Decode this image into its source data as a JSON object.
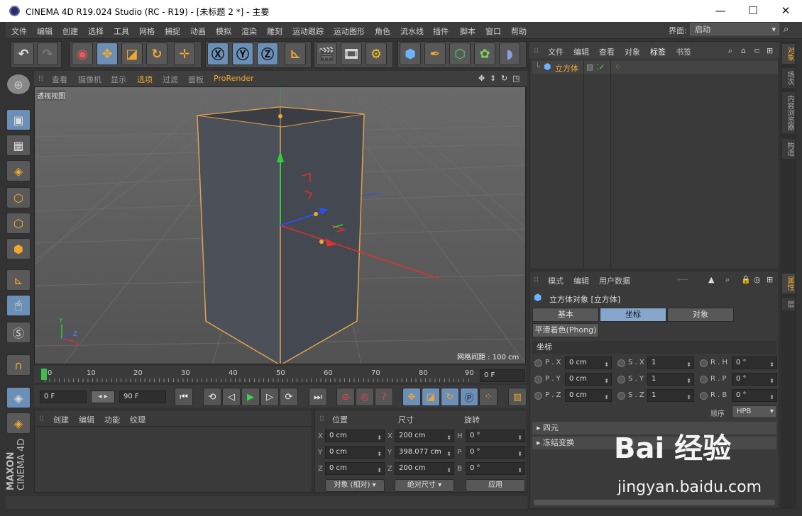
{
  "window": {
    "title": "CINEMA 4D R19.024 Studio (RC - R19) - [未标题 2 *] - 主要"
  },
  "menubar": {
    "items": [
      "文件",
      "编辑",
      "创建",
      "选择",
      "工具",
      "网格",
      "捕捉",
      "动画",
      "模拟",
      "渲染",
      "雕刻",
      "运动跟踪",
      "运动图形",
      "角色",
      "流水线",
      "插件",
      "脚本",
      "窗口",
      "帮助"
    ],
    "layout_label": "界面:",
    "layout_value": "启动"
  },
  "viewport": {
    "menu": [
      "查看",
      "摄像机",
      "显示",
      "选项",
      "过滤",
      "面板",
      "ProRender"
    ],
    "label": "透视视图",
    "grid_spacing": "网格间距 : 100 cm",
    "axis_x": "X",
    "axis_y": "Y",
    "axis_z": "Z"
  },
  "timeline": {
    "ticks": [
      "0",
      "10",
      "20",
      "30",
      "40",
      "50",
      "60",
      "70",
      "80",
      "90"
    ],
    "current_frame": "0 F"
  },
  "playback": {
    "start": "0 F",
    "end": "90 F"
  },
  "material_panel": {
    "menu": [
      "创建",
      "编辑",
      "功能",
      "纹理"
    ]
  },
  "coord_panel": {
    "headers": [
      "位置",
      "尺寸",
      "旋转"
    ],
    "position": {
      "x": "0 cm",
      "y": "0 cm",
      "z": "0 cm"
    },
    "size": {
      "x": "200 cm",
      "y": "398.077 cm",
      "z": "200 cm"
    },
    "rotation": {
      "h": "0 °",
      "p": "0 °",
      "b": "0 °"
    },
    "labels": {
      "x": "X",
      "y": "Y",
      "z": "Z",
      "h": "H",
      "p": "P",
      "b": "B"
    },
    "mode_dropdown": "对象 (相对)",
    "size_dropdown": "绝对尺寸",
    "apply_button": "应用"
  },
  "object_manager": {
    "menu": [
      "文件",
      "编辑",
      "查看",
      "对象",
      "标签",
      "书签"
    ],
    "objects": [
      {
        "name": "立方体"
      }
    ]
  },
  "attribute_manager": {
    "menu": [
      "模式",
      "编辑",
      "用户数据"
    ],
    "object_title": "立方体对象 [立方体]",
    "tabs": [
      "基本",
      "坐标",
      "对象"
    ],
    "phong_tab": "平滑着色(Phong)",
    "section_title": "坐标",
    "p_labels": [
      "P . X",
      "P . Y",
      "P . Z"
    ],
    "p_values": [
      "0 cm",
      "0 cm",
      "0 cm"
    ],
    "s_labels": [
      "S . X",
      "S . Y",
      "S . Z"
    ],
    "s_values": [
      "1",
      "1",
      "1"
    ],
    "r_labels": [
      "R . H",
      "R . P",
      "R . B"
    ],
    "r_values": [
      "0 °",
      "0 °",
      "0 °"
    ],
    "order_label": "顺序",
    "order_value": "HPB",
    "collapsed_sections": [
      "四元",
      "冻结变换"
    ]
  },
  "right_tabs_top": [
    "对象",
    "场次",
    "内容浏览器",
    "构造"
  ],
  "right_tabs_bottom": [
    "属性",
    "层"
  ],
  "brand": {
    "line1": "MAXON",
    "line2": "CINEMA 4D"
  },
  "watermark": {
    "logo": "Bai 经验",
    "url": "jingyan.baidu.com"
  },
  "colors": {
    "accent": "#f0a830",
    "selected_tab": "#86a6cc",
    "icon_active": "#6b8fb6"
  }
}
